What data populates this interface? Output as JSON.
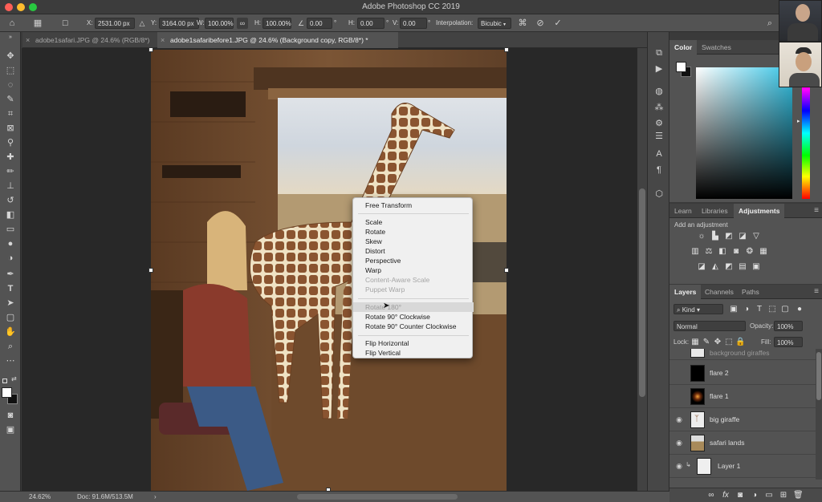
{
  "app": {
    "title": "Adobe Photoshop CC 2019"
  },
  "options_bar": {
    "x_label": "X:",
    "x_value": "2531.00 px",
    "y_label": "Y:",
    "y_value": "3164.00 px",
    "w_label": "W:",
    "w_value": "100.00%",
    "h_label": "H:",
    "h_value": "100.00%",
    "angle_value": "0.00",
    "angle_unit": "°",
    "hskew_label": "H:",
    "hskew_value": "0.00",
    "hskew_unit": "°",
    "vskew_label": "V:",
    "vskew_value": "0.00",
    "vskew_unit": "°",
    "interpolation_label": "Interpolation:",
    "interpolation_value": "Bicubic"
  },
  "doc_tabs": [
    {
      "label": "adobe1safari.JPG @ 24.6% (RGB/8*)",
      "active": false
    },
    {
      "label": "adobe1safaribefore1.JPG @ 24.6% (Background copy, RGB/8*) *",
      "active": true
    }
  ],
  "context_menu": {
    "items": [
      {
        "label": "Free Transform",
        "state": "enabled"
      },
      {
        "label": "Scale",
        "state": "enabled"
      },
      {
        "label": "Rotate",
        "state": "enabled"
      },
      {
        "label": "Skew",
        "state": "enabled"
      },
      {
        "label": "Distort",
        "state": "enabled"
      },
      {
        "label": "Perspective",
        "state": "enabled"
      },
      {
        "label": "Warp",
        "state": "enabled"
      },
      {
        "label": "Content-Aware Scale",
        "state": "disabled"
      },
      {
        "label": "Puppet Warp",
        "state": "disabled"
      },
      {
        "label": "Rotate 180°",
        "state": "hover"
      },
      {
        "label": "Rotate 90° Clockwise",
        "state": "enabled"
      },
      {
        "label": "Rotate 90° Counter Clockwise",
        "state": "enabled"
      },
      {
        "label": "Flip Horizontal",
        "state": "enabled"
      },
      {
        "label": "Flip Vertical",
        "state": "enabled"
      }
    ]
  },
  "status_bar": {
    "zoom": "24.62%",
    "doc": "Doc: 91.6M/513.5M",
    "arrow": "›"
  },
  "color_panel": {
    "tabs": [
      "Color",
      "Swatches"
    ],
    "foreground": "#ffffff",
    "background": "#101010"
  },
  "adjustments_panel": {
    "tabs": [
      "Learn",
      "Libraries",
      "Adjustments"
    ],
    "heading": "Add an adjustment",
    "row1_icons": [
      "brightness-icon",
      "levels-icon",
      "curves-icon",
      "exposure-icon",
      "vibrance-icon"
    ],
    "row2_icons": [
      "hue-saturation-icon",
      "color-balance-icon",
      "black-white-icon",
      "photo-filter-icon",
      "channel-mixer-icon",
      "color-lookup-icon"
    ],
    "row3_icons": [
      "invert-icon",
      "posterize-icon",
      "threshold-icon",
      "gradient-map-icon",
      "selective-color-icon"
    ]
  },
  "layers_panel": {
    "tabs": [
      "Layers",
      "Channels",
      "Paths"
    ],
    "filter_value": "Kind",
    "blend_mode": "Normal",
    "opacity_label": "Opacity:",
    "opacity_value": "100%",
    "lock_label": "Lock:",
    "fill_label": "Fill:",
    "fill_value": "100%",
    "partial_layer": "background giraffes",
    "layers": [
      {
        "name": "flare 2",
        "visible": false
      },
      {
        "name": "flare 1",
        "visible": false
      },
      {
        "name": "big giraffe",
        "visible": true
      },
      {
        "name": "safari lands",
        "visible": true
      },
      {
        "name": "Layer 1",
        "visible": true
      }
    ]
  }
}
